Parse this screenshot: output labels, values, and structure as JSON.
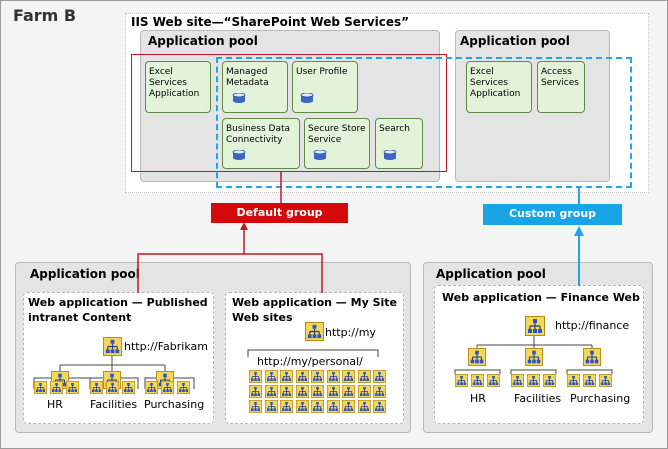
{
  "farm_title": "Farm B",
  "iis_title": "IIS Web site—“SharePoint Web Services”",
  "app_pool_label": "Application pool",
  "services_left": [
    {
      "id": "excel",
      "label": "Excel\nServices\nApplication"
    },
    {
      "id": "managed-metadata",
      "label": "Managed\nMetadata"
    },
    {
      "id": "user-profile",
      "label": "User Profile"
    },
    {
      "id": "business-data",
      "label": "Business Data\nConnectivity"
    },
    {
      "id": "secure-store",
      "label": "Secure Store\nService"
    },
    {
      "id": "search",
      "label": "Search"
    }
  ],
  "services_right": [
    {
      "id": "excel-right",
      "label": "Excel\nServices\nApplication"
    },
    {
      "id": "access",
      "label": "Access\nServices"
    }
  ],
  "groups": {
    "default": "Default group",
    "custom": "Custom group"
  },
  "colors": {
    "default_group": "#d20a0a",
    "custom_group": "#17a5e6",
    "service_fill": "#e3f3d9",
    "service_border": "#5f8a45"
  },
  "web_apps": {
    "published": {
      "title": "Web application — Published intranet Content",
      "url": "http://Fabrikam",
      "sites": [
        "HR",
        "Facilities",
        "Purchasing"
      ]
    },
    "mysite": {
      "title": "Web application — My Site Web sites",
      "url": "http://my",
      "personal": "http://my/personal/"
    },
    "finance": {
      "title": "Web application — Finance Web",
      "url": "http://finance",
      "sites": [
        "HR",
        "Facilities",
        "Purchasing"
      ]
    }
  },
  "icons": {
    "site": "site-hierarchy-icon",
    "database": "database-icon"
  }
}
